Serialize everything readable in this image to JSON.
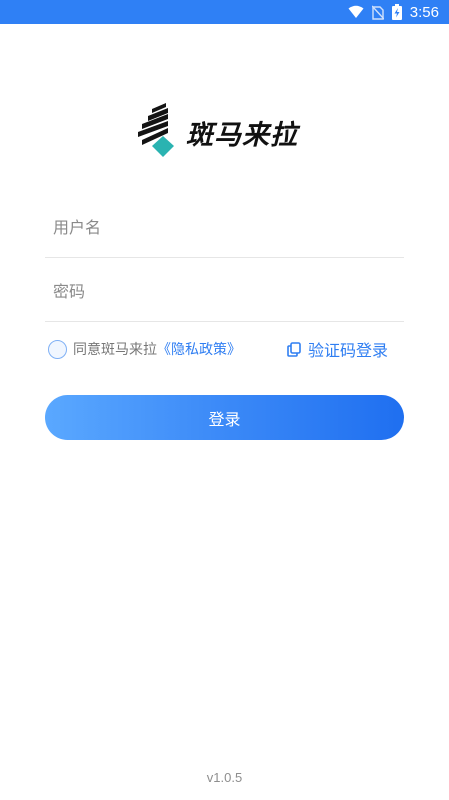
{
  "status_bar": {
    "time": "3:56",
    "icons": [
      "wifi-icon",
      "no-sim-icon",
      "battery-charging-icon"
    ]
  },
  "brand": {
    "name": "斑马来拉",
    "accent_color": "#2ab3b1"
  },
  "form": {
    "username_placeholder": "用户名",
    "username_value": "",
    "password_placeholder": "密码",
    "password_value": ""
  },
  "agreement": {
    "checked": false,
    "text": "同意斑马来拉",
    "policy_link": "《隐私政策》"
  },
  "sms_login": {
    "label": "验证码登录",
    "icon": "copy-icon"
  },
  "login_button": {
    "label": "登录"
  },
  "footer": {
    "version": "v1.0.5"
  },
  "colors": {
    "primary": "#2f7ef2",
    "status_bar": "#2f80f5"
  }
}
